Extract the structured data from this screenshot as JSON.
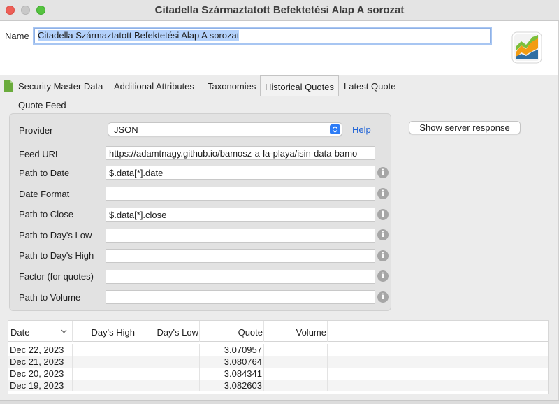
{
  "window": {
    "title": "Citadella Származtatott Befektetési Alap A sorozat"
  },
  "header": {
    "name_label": "Name",
    "name_value": "Citadella Származtatott Befektetési Alap A sorozat"
  },
  "tabs": [
    {
      "label": "Security Master Data"
    },
    {
      "label": "Additional Attributes"
    },
    {
      "label": "Taxonomies"
    },
    {
      "label": "Historical Quotes",
      "active": true
    },
    {
      "label": "Latest Quote"
    }
  ],
  "quote_feed": {
    "section_label": "Quote Feed",
    "provider_label": "Provider",
    "provider_value": "JSON",
    "help_label": "Help",
    "show_server_response": "Show server response",
    "fields": [
      {
        "label": "Feed URL",
        "value": "https://adamtnagy.github.io/bamosz-a-la-playa/isin-data-bamo"
      },
      {
        "label": "Path to Date",
        "value": "$.data[*].date"
      },
      {
        "label": "Date Format",
        "value": ""
      },
      {
        "label": "Path to Close",
        "value": "$.data[*].close"
      },
      {
        "label": "Path to Day's Low",
        "value": ""
      },
      {
        "label": "Path to Day's High",
        "value": ""
      },
      {
        "label": "Factor (for quotes)",
        "value": ""
      },
      {
        "label": "Path to Volume",
        "value": ""
      }
    ]
  },
  "table": {
    "columns": [
      "Date",
      "Day's High",
      "Day's Low",
      "Quote",
      "Volume"
    ],
    "rows": [
      {
        "date": "Dec 22, 2023",
        "high": "",
        "low": "",
        "quote": "3.070957",
        "volume": ""
      },
      {
        "date": "Dec 21, 2023",
        "high": "",
        "low": "",
        "quote": "3.080764",
        "volume": ""
      },
      {
        "date": "Dec 20, 2023",
        "high": "",
        "low": "",
        "quote": "3.084341",
        "volume": ""
      },
      {
        "date": "Dec 19, 2023",
        "high": "",
        "low": "",
        "quote": "3.082603",
        "volume": ""
      }
    ]
  },
  "icons": {
    "close": "close-icon",
    "minimize": "minimize-icon",
    "maximize": "maximize-icon",
    "logo": "portfolio-chart-logo-icon",
    "document": "document-icon",
    "info": "info-icon",
    "select_arrow": "select-arrows-icon",
    "sort": "chevron-down-icon"
  }
}
